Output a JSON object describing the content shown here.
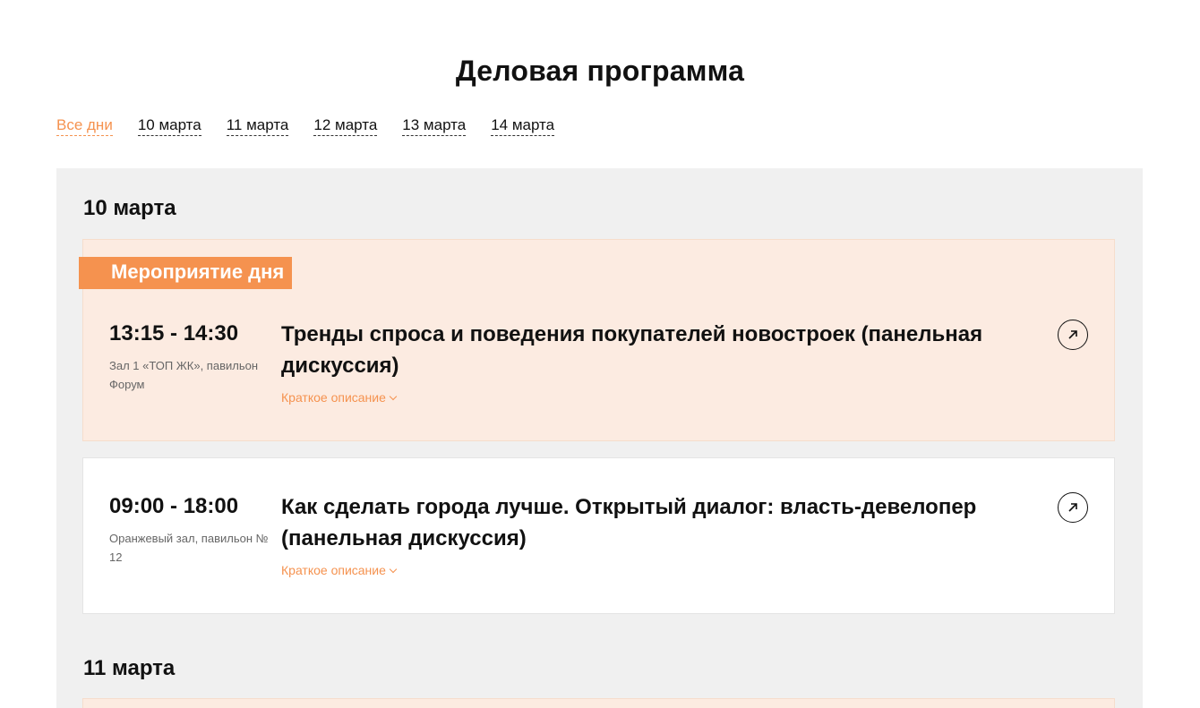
{
  "page_title": "Деловая программа",
  "day_tabs": [
    {
      "label": "Все дни",
      "active": true
    },
    {
      "label": "10 марта",
      "active": false
    },
    {
      "label": "11 марта",
      "active": false
    },
    {
      "label": "12 марта",
      "active": false
    },
    {
      "label": "13 марта",
      "active": false
    },
    {
      "label": "14 марта",
      "active": false
    }
  ],
  "days": [
    {
      "heading": "10 марта",
      "events": [
        {
          "badge": "Мероприятие дня",
          "time": "13:15 - 14:30",
          "venue": "Зал 1 «ТОП ЖК», павильон Форум",
          "title": "Тренды спроса и поведения покупателей новостроек (панельная дискуссия)",
          "desc_toggle": "Краткое описание",
          "featured": true
        },
        {
          "time": "09:00 - 18:00",
          "venue": "Оранжевый зал, павильон № 12",
          "title": "Как сделать города лучше. Открытый диалог: власть-девелопер (панельная дискуссия)",
          "desc_toggle": "Краткое описание",
          "featured": false
        }
      ]
    },
    {
      "heading": "11 марта",
      "events": []
    }
  ],
  "colors": {
    "accent": "#f5924f",
    "featured_bg": "#fcebe1",
    "section_bg": "#f0f0f0"
  },
  "icons": {
    "open": "arrow-up-right-icon",
    "expand": "chevron-down-icon"
  }
}
